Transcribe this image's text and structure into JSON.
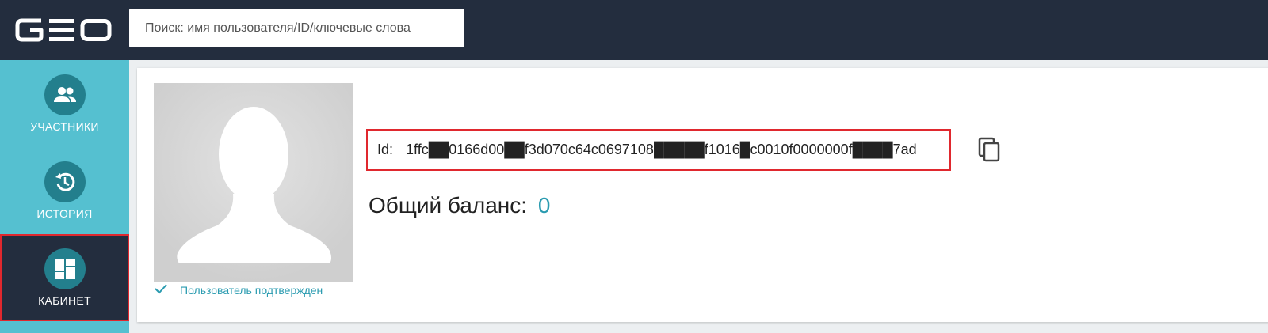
{
  "header": {
    "logo_text": "GEO",
    "search": {
      "placeholder": "Поиск: имя пользователя/ID/ключевые слова",
      "value": ""
    }
  },
  "sidebar": {
    "items": [
      {
        "label": "УЧАСТНИКИ",
        "icon": "people-icon",
        "active": false
      },
      {
        "label": "ИСТОРИЯ",
        "icon": "history-icon",
        "active": false
      },
      {
        "label": "КАБИНЕТ",
        "icon": "dashboard-icon",
        "active": true
      }
    ]
  },
  "profile": {
    "avatar_icon": "avatar-silhouette",
    "verified_label": "Пользователь подтвержден",
    "id_label": "Id:",
    "id_value": "1ffc██0166d00██f3d070c64c0697108█████f1016█c0010f0000000f████7ad",
    "balance_label": "Общий баланс:",
    "balance_value": "0"
  },
  "colors": {
    "header_bg": "#232d3e",
    "sidebar_bg": "#55c0d0",
    "icon_circle": "#237f8d",
    "accent": "#2a9bb0",
    "highlight_border": "#e0282e"
  }
}
